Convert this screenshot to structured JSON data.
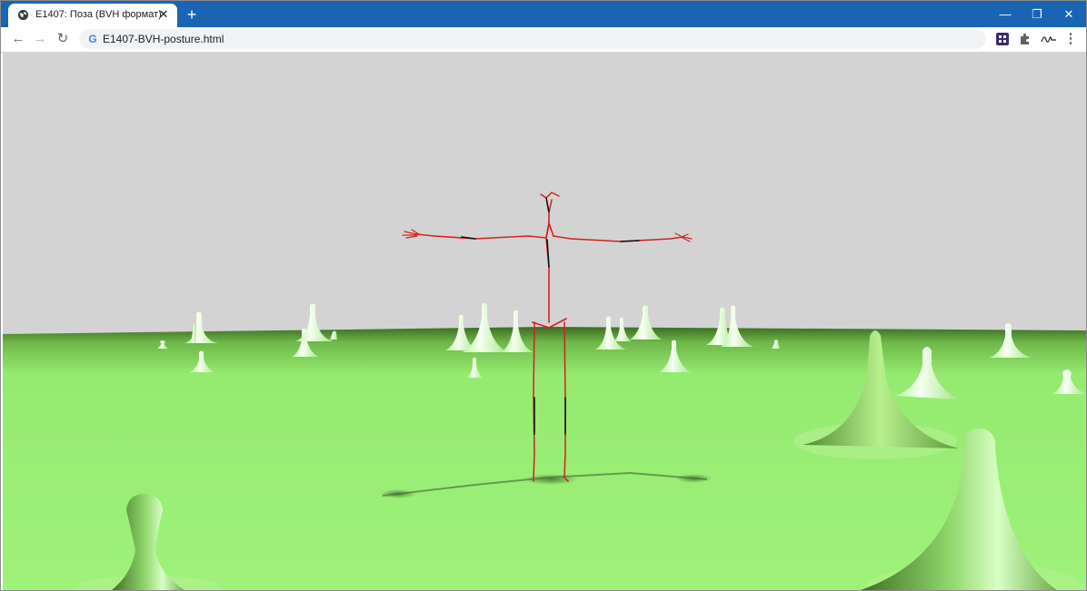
{
  "browser": {
    "tab": {
      "title": "E1407: Поза (BVH формат)",
      "close_symbol": "✕"
    },
    "new_tab_symbol": "+",
    "window_controls": {
      "minimize": "—",
      "restore": "❐",
      "close": "✕"
    },
    "nav": {
      "back": "←",
      "forward": "→",
      "reload": "↻"
    },
    "address": {
      "favicon_letter": "G",
      "url": "E1407-BVH-posture.html"
    },
    "extensions": [
      "grid-extension-icon",
      "puzzle-extension-icon",
      "signature-extension-icon"
    ],
    "menu_symbol": "⋮"
  },
  "scene": {
    "sky_color": "#d3d3d3",
    "ground_color": "#9ef27a",
    "skeleton_colors": [
      "#d42020",
      "#111111"
    ]
  }
}
